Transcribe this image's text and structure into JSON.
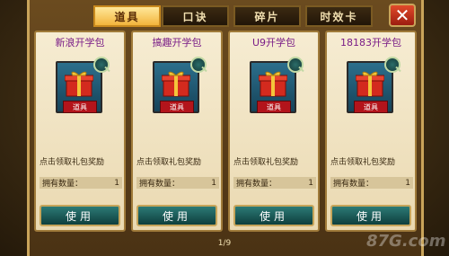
{
  "tabs": [
    {
      "label": "道具",
      "active": true
    },
    {
      "label": "口诀",
      "active": false
    },
    {
      "label": "碎片",
      "active": false
    },
    {
      "label": "时效卡",
      "active": false
    }
  ],
  "close_label": "✕",
  "cards": [
    {
      "title": "新浪开学包",
      "prop_label": "道具",
      "desc": "点击领取礼包奖励",
      "count_label": "拥有数量：",
      "count": "1",
      "button": "使用"
    },
    {
      "title": "搞趣开学包",
      "prop_label": "道具",
      "desc": "点击领取礼包奖励",
      "count_label": "拥有数量：",
      "count": "1",
      "button": "使用"
    },
    {
      "title": "U9开学包",
      "prop_label": "道具",
      "desc": "点击领取礼包奖励",
      "count_label": "拥有数量：",
      "count": "1",
      "button": "使用"
    },
    {
      "title": "18183开学包",
      "prop_label": "道具",
      "desc": "点击领取礼包奖励",
      "count_label": "拥有数量：",
      "count": "1",
      "button": "使用"
    }
  ],
  "pager": "1/9",
  "watermark": "87G.com",
  "colors": {
    "active_tab": "#f2b43c",
    "title_purple": "#7a1d87",
    "button_teal": "#2c7a76",
    "prop_red": "#b3141b"
  }
}
